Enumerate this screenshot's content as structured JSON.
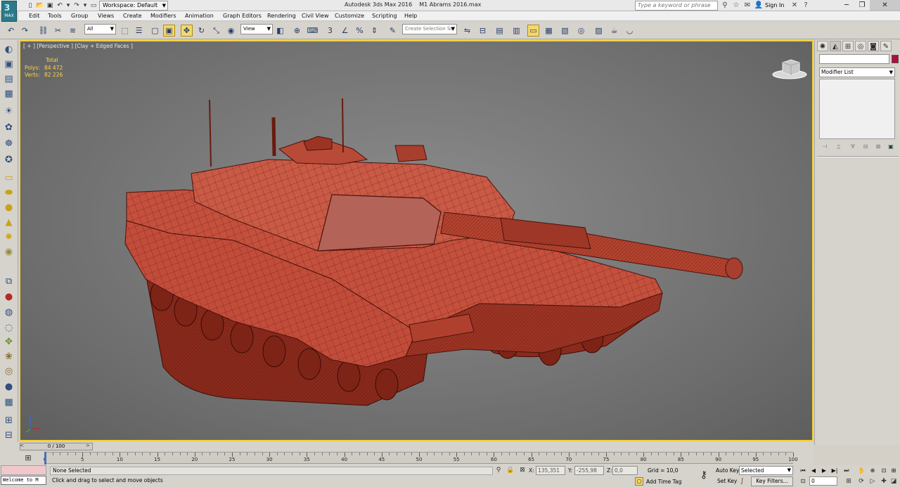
{
  "title_bar": {
    "logo_text": "MAX",
    "workspace_label": "Workspace: Default",
    "app_name": "Autodesk 3ds Max 2016",
    "file_name": "M1 Abrams 2016.max",
    "search_placeholder": "Type a keyword or phrase",
    "sign_in": "Sign In"
  },
  "menu": [
    "Edit",
    "Tools",
    "Group",
    "Views",
    "Create",
    "Modifiers",
    "Animation",
    "Graph Editors",
    "Rendering",
    "Civil View",
    "Customize",
    "Scripting",
    "Help"
  ],
  "toolbar": {
    "selection_filter": "All",
    "ref_coord": "View",
    "snaps_label": "3",
    "selection_set_placeholder": "Create Selection Se"
  },
  "viewport": {
    "label": "[ + ] [Perspective ] [Clay + Edged Faces ]",
    "stats": {
      "header": "Total",
      "polys_label": "Polys:",
      "polys_value": "84 472",
      "verts_label": "Verts:",
      "verts_value": "82 226"
    },
    "model_color": "#c8503e"
  },
  "command_panel": {
    "modifier_list": "Modifier List",
    "object_color": "#b10d3c"
  },
  "timeline": {
    "frame_counter": "0 / 100",
    "ticks": [
      0,
      5,
      10,
      15,
      20,
      25,
      30,
      35,
      40,
      45,
      50,
      55,
      60,
      65,
      70,
      75,
      80,
      85,
      90,
      95,
      100
    ]
  },
  "status": {
    "maxscript": "Welcome to M",
    "selection": "None Selected",
    "prompt": "Click and drag to select and move objects",
    "x_label": "X:",
    "x_value": "135,351",
    "y_label": "Y:",
    "y_value": "-255,98",
    "z_label": "Z:",
    "z_value": "0,0",
    "grid": "Grid = 10,0",
    "add_time_tag": "Add Time Tag",
    "auto_key": "Auto Key",
    "set_key": "Set Key",
    "key_mode": "Selected",
    "key_filters": "Key Filters...",
    "frame": "0"
  }
}
